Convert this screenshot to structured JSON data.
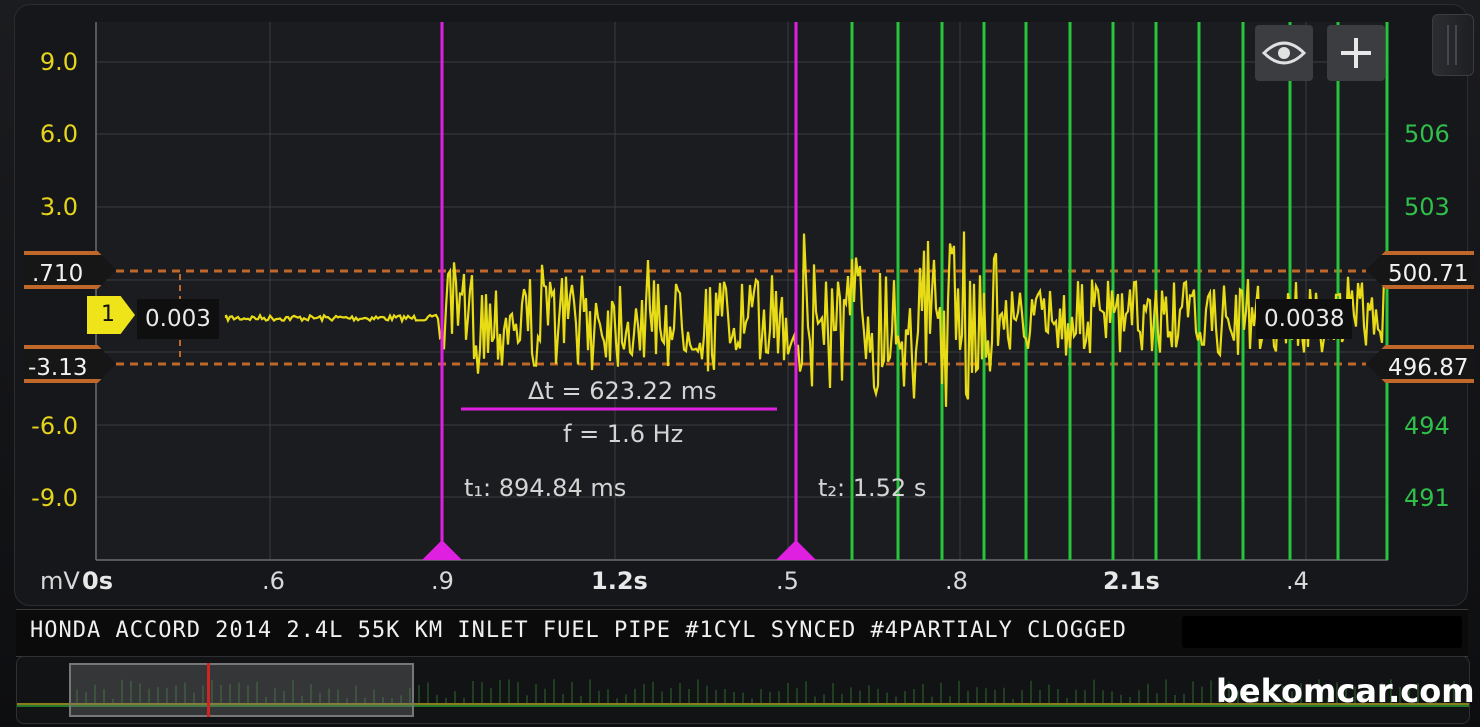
{
  "colors": {
    "trace": "#e8dc16",
    "cursor": "#e020e0",
    "green_markers": "#27c43c",
    "ref_lines": "#c0682a",
    "grid": "#3a3d42"
  },
  "axis_left": {
    "unit": "mV",
    "ticks": [
      "9.0",
      "6.0",
      "3.0",
      "-6.0",
      "-9.0"
    ]
  },
  "axis_right": {
    "ticks": [
      "506",
      "503",
      "494",
      "491"
    ]
  },
  "axis_x": {
    "labels": [
      "0s",
      ".6",
      ".9",
      "1.2s",
      ".5",
      ".8",
      "2.1s",
      ".4"
    ]
  },
  "reference": {
    "upper_left": ".710",
    "lower_left": "-3.13",
    "upper_right": "500.71",
    "lower_right": "496.87"
  },
  "channel": {
    "number": "1",
    "value_left": "0.003",
    "value_right": "0.0038"
  },
  "cursors": {
    "delta_t": "Δt = 623.22 ms",
    "freq": "f = 1.6 Hz",
    "t1": "t₁: 894.84 ms",
    "t2": "t₂: 1.52 s"
  },
  "toolbar": {
    "eye_icon": "eye-icon",
    "add_icon": "plus-icon"
  },
  "capture_title": "HONDA ACCORD 2014 2.4L 55K KM INLET FUEL PIPE #1CYL SYNCED #4PARTIALY CLOGGED",
  "watermark": "bekomcar.com"
}
